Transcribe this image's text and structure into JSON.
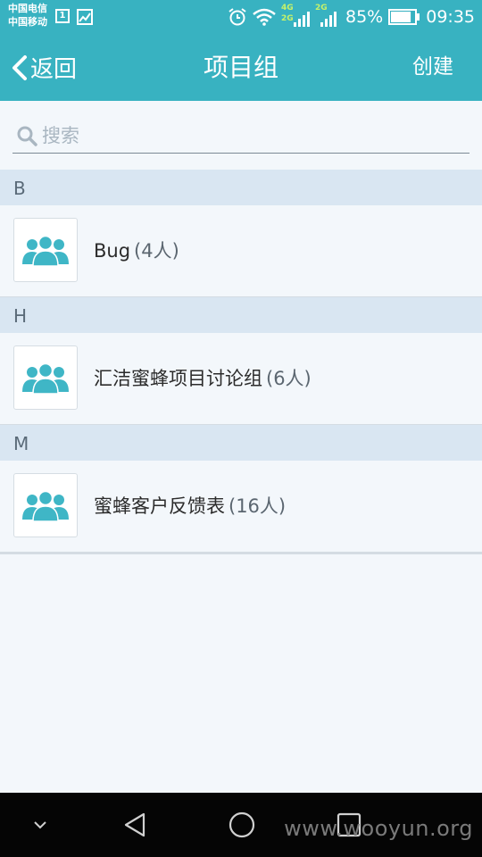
{
  "status_bar": {
    "carrier_1": "中国电信",
    "carrier_2": "中国移动",
    "sim_label": "1",
    "net_label_a": "4G",
    "net_label_b": "2G",
    "net_label_c": "2G",
    "battery": "85%",
    "time": "09:35",
    "battery_level": 0.85,
    "icons": [
      "sim-card-icon",
      "image-icon",
      "alarm-icon",
      "wifi-icon",
      "signal-icon",
      "battery-icon"
    ]
  },
  "header": {
    "back_label": "返回",
    "title": "项目组",
    "create_label": "创建"
  },
  "search": {
    "placeholder": "搜索"
  },
  "sections": [
    {
      "letter": "B",
      "items": [
        {
          "name": "Bug",
          "count": "(4人)"
        }
      ]
    },
    {
      "letter": "H",
      "items": [
        {
          "name": "汇洁蜜蜂项目讨论组",
          "count": "(6人)"
        }
      ]
    },
    {
      "letter": "M",
      "items": [
        {
          "name": "蜜蜂客户反馈表",
          "count": "(16人)"
        }
      ]
    }
  ],
  "nav_bar": {
    "watermark": "www.wooyun.org"
  },
  "colors": {
    "accent": "#38b2c1",
    "avatar_icon": "#3fb6c6",
    "section_bg": "#d9e6f2",
    "page_bg": "#f3f7fb"
  }
}
